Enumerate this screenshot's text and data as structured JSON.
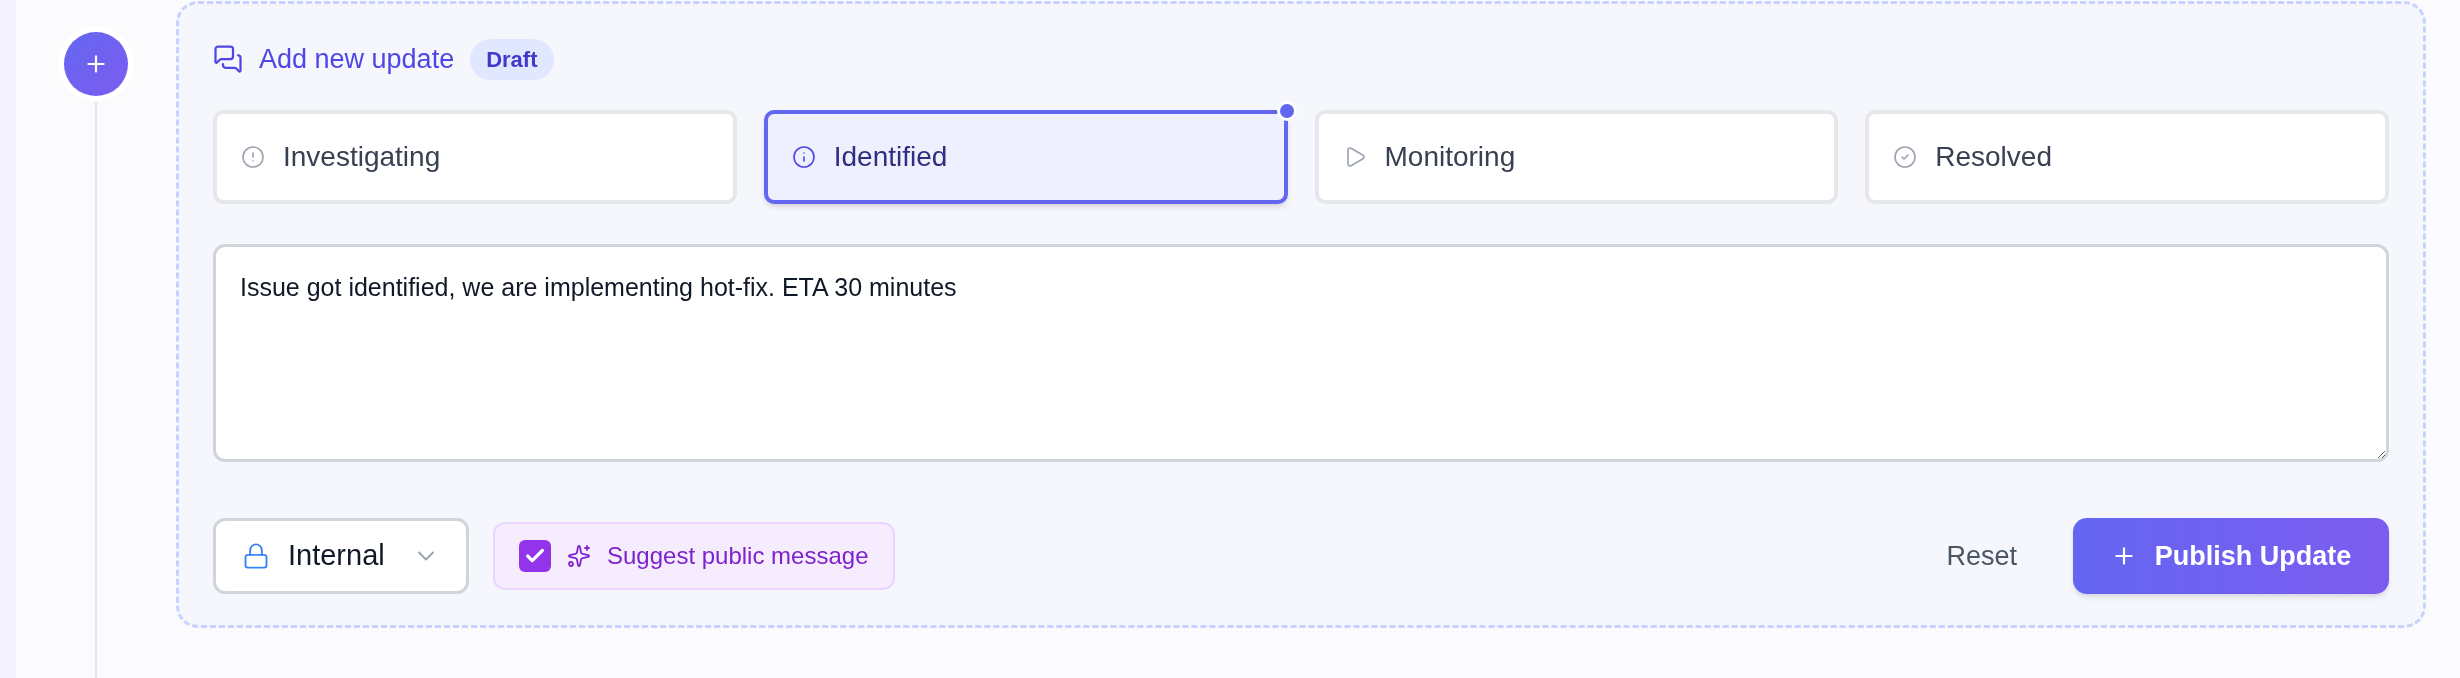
{
  "header": {
    "title": "Add new update",
    "badge": "Draft"
  },
  "statuses": [
    {
      "kind": "alert",
      "label": "Investigating",
      "selected": false
    },
    {
      "kind": "info",
      "label": "Identified",
      "selected": true
    },
    {
      "kind": "play",
      "label": "Monitoring",
      "selected": false
    },
    {
      "kind": "check",
      "label": "Resolved",
      "selected": false
    }
  ],
  "message": {
    "value": "Issue got identified, we are implementing hot-fix. ETA 30 minutes"
  },
  "visibility": {
    "value": "Internal"
  },
  "suggest": {
    "label": "Suggest public message",
    "checked": true
  },
  "buttons": {
    "reset": "Reset",
    "publish": "Publish Update"
  }
}
